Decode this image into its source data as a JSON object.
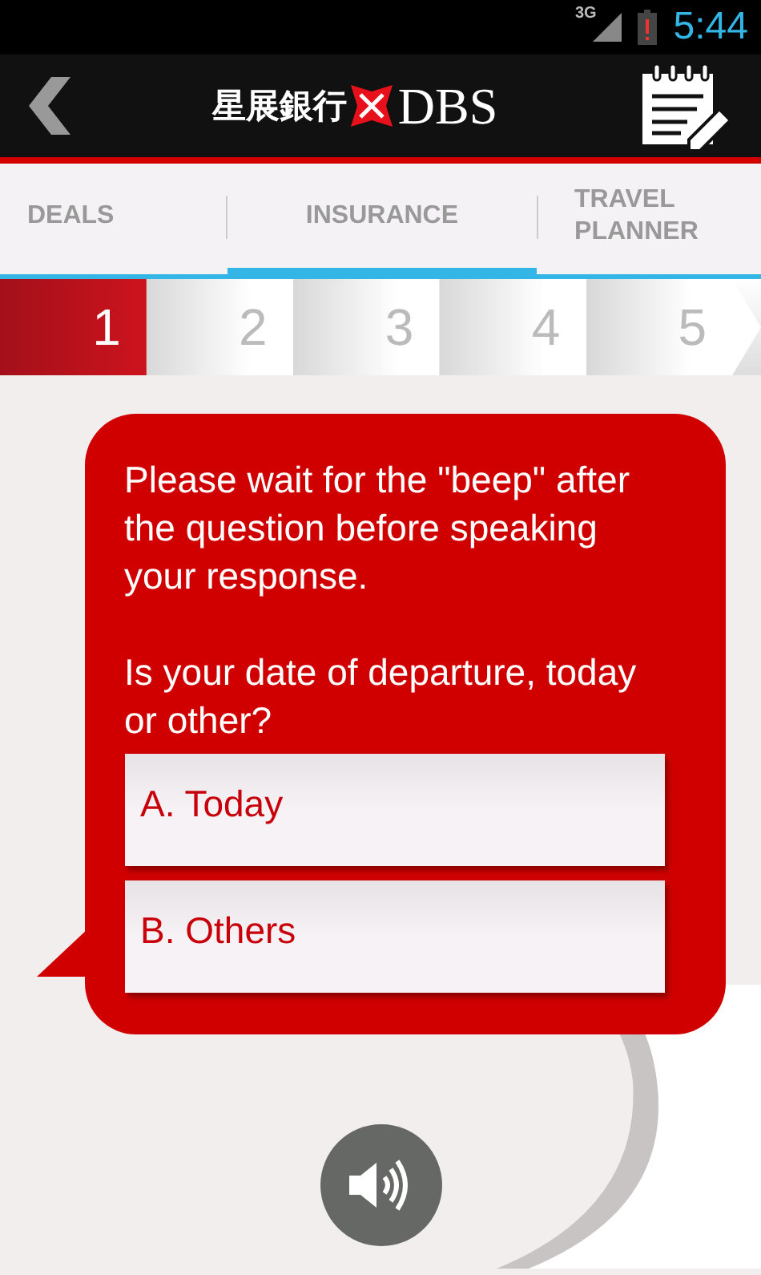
{
  "status_bar": {
    "network": "3G",
    "time": "5:44"
  },
  "app_bar": {
    "logo_chinese": "星展銀行",
    "logo_text": "DBS"
  },
  "tabs": [
    {
      "label": "DEALS",
      "selected": false
    },
    {
      "label": "INSURANCE",
      "selected": true
    },
    {
      "label": "TRAVEL PLANNER",
      "selected": false
    }
  ],
  "steps": [
    {
      "label": "1",
      "selected": true
    },
    {
      "label": "2",
      "selected": false
    },
    {
      "label": "3",
      "selected": false
    },
    {
      "label": "4",
      "selected": false
    },
    {
      "label": "5",
      "selected": false
    }
  ],
  "prompt": {
    "instruction": "Please wait for the \"beep\" after the question before speaking your response.",
    "question": "Is your date of departure, today or other?"
  },
  "options": [
    {
      "label": "A. Today"
    },
    {
      "label": "B. Others"
    }
  ]
}
